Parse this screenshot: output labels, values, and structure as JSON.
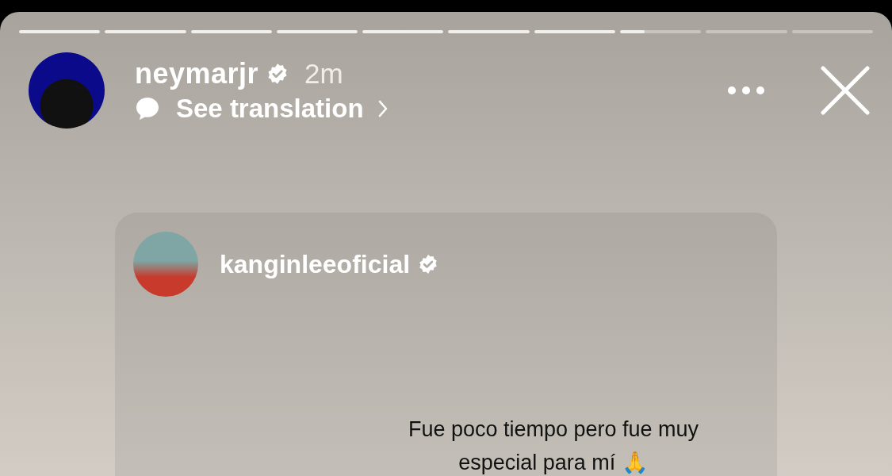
{
  "progress": [
    {
      "level": 1
    },
    {
      "level": 1
    },
    {
      "level": 1
    },
    {
      "level": 1
    },
    {
      "level": 1
    },
    {
      "level": 1
    },
    {
      "level": 1
    },
    {
      "level": 0.3
    },
    {
      "level": 0
    },
    {
      "level": 0
    }
  ],
  "header": {
    "username": "neymarjr",
    "verified": true,
    "time": "2m",
    "translation": "See translation"
  },
  "shared_post": {
    "username": "kanginleeoficial",
    "verified": true,
    "caption": "Fue poco tiempo pero fue muy especial para mí 🙏"
  }
}
